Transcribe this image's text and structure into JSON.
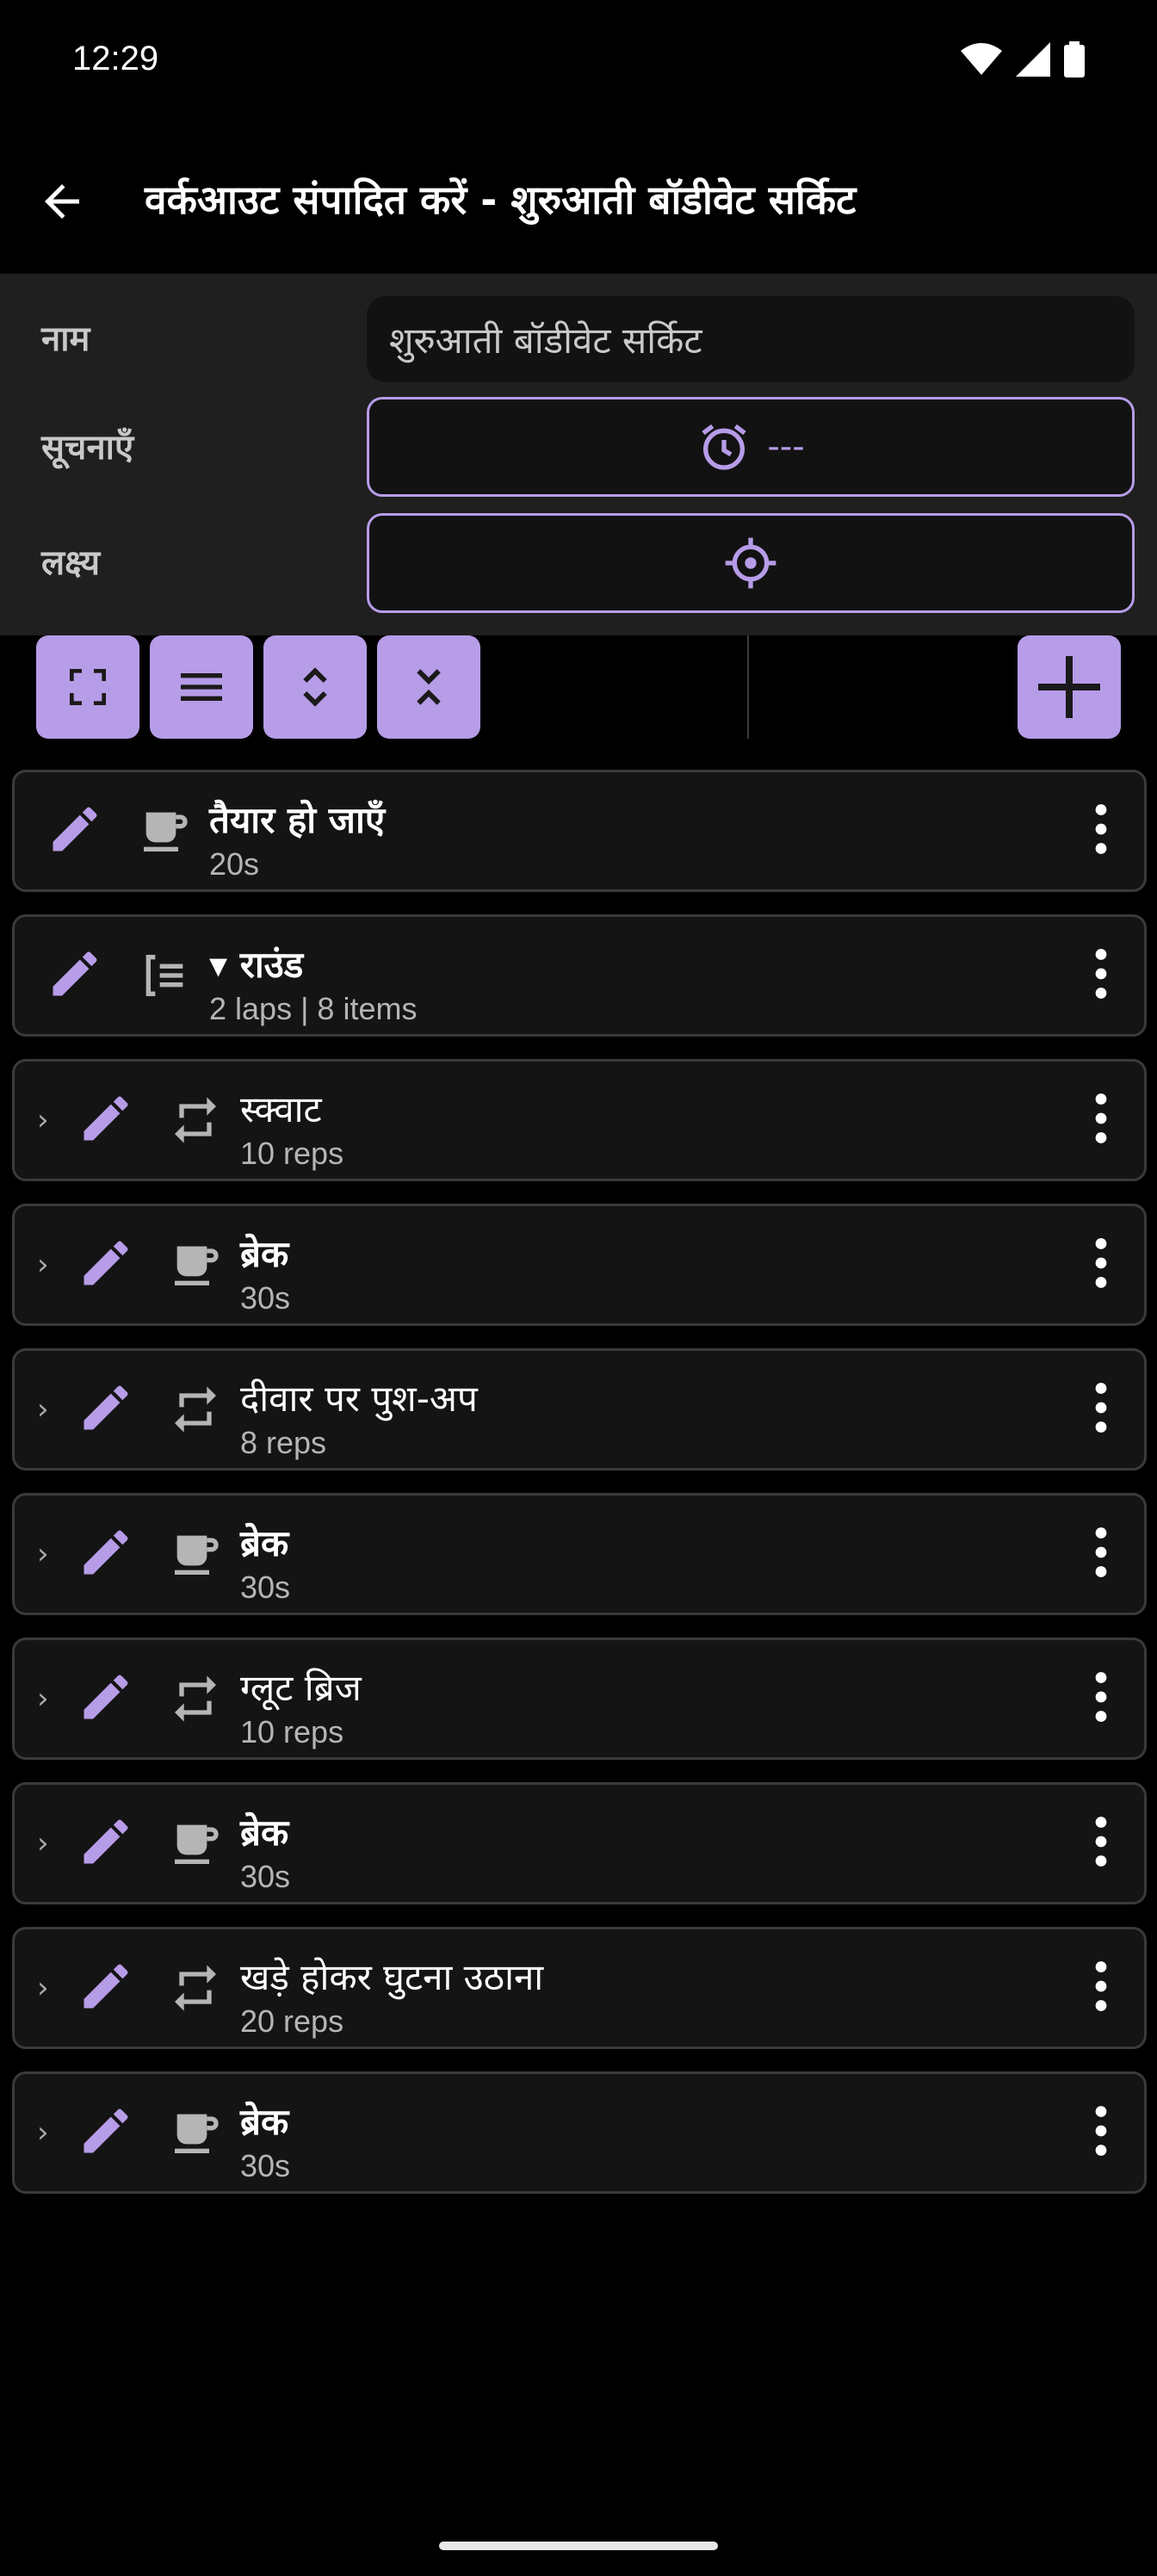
{
  "status": {
    "time": "12:29"
  },
  "app_bar": {
    "title": "वर्कआउट संपादित करें - शुरुआती बॉडीवेट सर्किट"
  },
  "form": {
    "name_label": "नाम",
    "name_value": "शुरुआती बॉडीवेट सर्किट",
    "notifications_label": "सूचनाएँ",
    "notifications_value": "---",
    "goal_label": "लक्ष्य"
  },
  "toolbar": {
    "buttons": [
      "expand-icon",
      "list-icon",
      "unfold-more-icon",
      "unfold-less-icon"
    ],
    "add": "plus-icon"
  },
  "colors": {
    "accent": "#b79ce8",
    "background": "#000000",
    "panel": "#1f1f1f",
    "row_bg": "#141414",
    "row_border": "#3a3a3a"
  },
  "rows": [
    {
      "title": "तैयार हो जाएँ",
      "sub": "20s",
      "type": "break",
      "bold": true,
      "nested": false
    },
    {
      "title": "▾ राउंड",
      "sub": "2 laps | 8 items",
      "type": "round",
      "bold": true,
      "nested": false
    },
    {
      "title": "स्क्वाट",
      "sub": "10 reps",
      "type": "reps",
      "bold": false,
      "nested": true
    },
    {
      "title": "ब्रेक",
      "sub": "30s",
      "type": "break",
      "bold": true,
      "nested": true
    },
    {
      "title": "दीवार पर पुश-अप",
      "sub": "8 reps",
      "type": "reps",
      "bold": false,
      "nested": true
    },
    {
      "title": "ब्रेक",
      "sub": "30s",
      "type": "break",
      "bold": true,
      "nested": true
    },
    {
      "title": "ग्लूट ब्रिज",
      "sub": "10 reps",
      "type": "reps",
      "bold": false,
      "nested": true
    },
    {
      "title": "ब्रेक",
      "sub": "30s",
      "type": "break",
      "bold": true,
      "nested": true
    },
    {
      "title": "खड़े होकर घुटना उठाना",
      "sub": "20 reps",
      "type": "reps",
      "bold": false,
      "nested": true
    },
    {
      "title": "ब्रेक",
      "sub": "30s",
      "type": "break",
      "bold": true,
      "nested": true
    }
  ]
}
